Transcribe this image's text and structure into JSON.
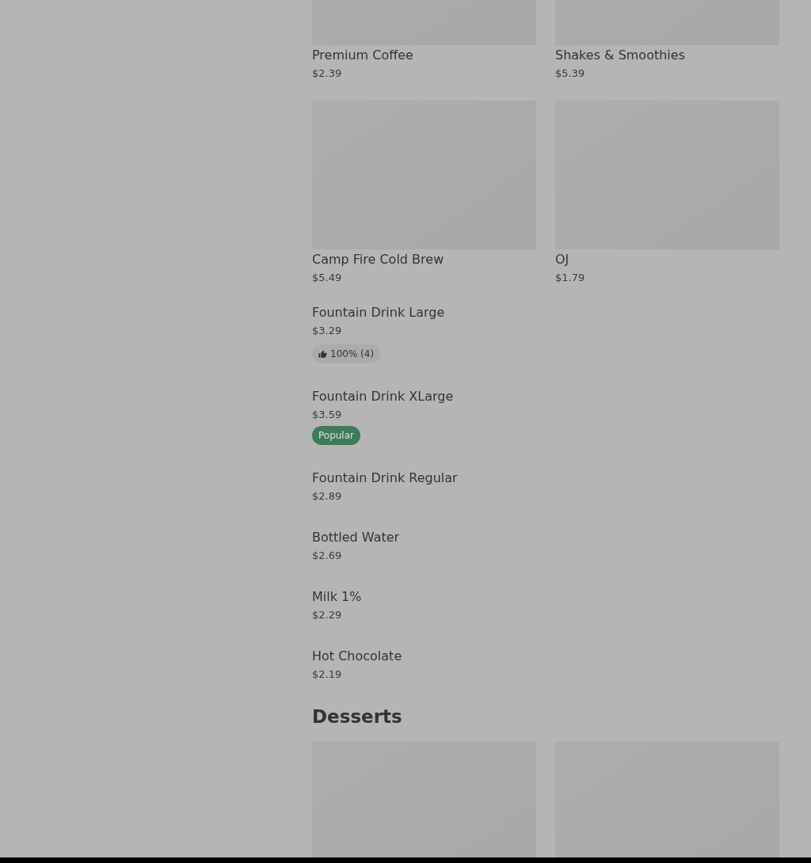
{
  "menu_section": {
    "cards": [
      {
        "name": "Premium Coffee",
        "price": "$2.39",
        "kind": "picture"
      },
      {
        "name": "Shakes & Smoothies",
        "price": "$5.39",
        "kind": "picture"
      },
      {
        "name": "Camp Fire Cold Brew",
        "price": "$5.49",
        "kind": "picture"
      },
      {
        "name": "OJ",
        "price": "$1.79",
        "kind": "picture"
      }
    ],
    "items": [
      {
        "name": "Fountain Drink Large",
        "price": "$3.29",
        "badge": {
          "kind": "rating",
          "text": "100% (4)"
        }
      },
      {
        "name": "Fountain Drink XLarge",
        "price": "$3.59",
        "badge": {
          "kind": "popular",
          "text": "Popular"
        }
      },
      {
        "name": "Fountain Drink Regular",
        "price": "$2.89"
      },
      {
        "name": "Bottled Water",
        "price": "$2.69"
      },
      {
        "name": "Milk 1%",
        "price": "$2.29"
      },
      {
        "name": "Hot Chocolate",
        "price": "$2.19"
      }
    ]
  },
  "desserts": {
    "title": "Desserts"
  }
}
